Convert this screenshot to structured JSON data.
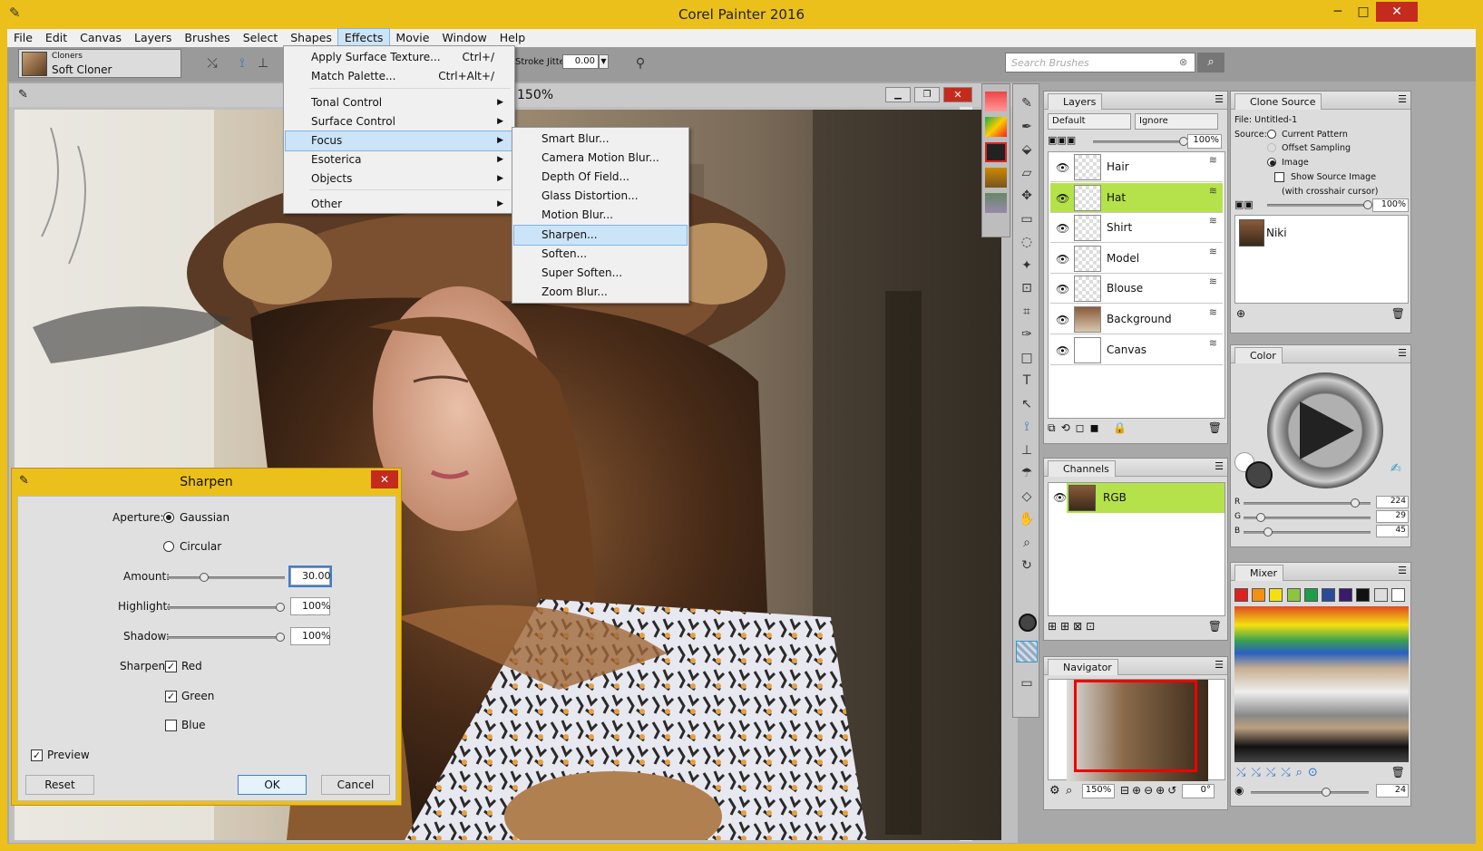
{
  "app": {
    "title": "Corel Painter 2016"
  },
  "menu": [
    "File",
    "Edit",
    "Canvas",
    "Layers",
    "Brushes",
    "Select",
    "Shapes",
    "Effects",
    "Movie",
    "Window",
    "Help"
  ],
  "propbar": {
    "brush_category": "Cloners",
    "brush_variant": "Soft Cloner",
    "stroke_jitter_label": "Stroke Jitter:",
    "stroke_jitter_value": "0.00"
  },
  "search": {
    "placeholder": "Search Brushes"
  },
  "document": {
    "zoom_label": "150%"
  },
  "effects_menu": {
    "items": [
      {
        "label": "Apply Surface Texture...",
        "shortcut": "Ctrl+/"
      },
      {
        "label": "Match Palette...",
        "shortcut": "Ctrl+Alt+/"
      },
      {
        "label": "Tonal Control"
      },
      {
        "label": "Surface Control"
      },
      {
        "label": "Focus"
      },
      {
        "label": "Esoterica"
      },
      {
        "label": "Objects"
      },
      {
        "label": "Other"
      }
    ]
  },
  "focus_menu": {
    "items": [
      "Smart Blur...",
      "Camera Motion Blur...",
      "Depth Of Field...",
      "Glass Distortion...",
      "Motion Blur...",
      "Sharpen...",
      "Soften...",
      "Super Soften...",
      "Zoom Blur..."
    ]
  },
  "sharpen_dialog": {
    "title": "Sharpen",
    "aperture_label": "Aperture:",
    "aperture_options": [
      "Gaussian",
      "Circular"
    ],
    "aperture_selected": "Gaussian",
    "amount_label": "Amount:",
    "amount_value": "30.00",
    "amount_level": 0.3,
    "highlight_label": "Highlight:",
    "highlight_value": "100%",
    "highlight_level": 1.0,
    "shadow_label": "Shadow:",
    "shadow_value": "100%",
    "shadow_level": 1.0,
    "sharpen_label": "Sharpen:",
    "channels": [
      {
        "label": "Red",
        "checked": true
      },
      {
        "label": "Green",
        "checked": true
      },
      {
        "label": "Blue",
        "checked": false
      }
    ],
    "preview_label": "Preview",
    "reset_label": "Reset",
    "ok_label": "OK",
    "cancel_label": "Cancel"
  },
  "layers_panel": {
    "title": "Layers",
    "composite_method": "Default",
    "preserve": "Ignore",
    "opacity": "100%",
    "layers": [
      {
        "name": "Hair",
        "selected": false
      },
      {
        "name": "Hat",
        "selected": true
      },
      {
        "name": "Shirt",
        "selected": false
      },
      {
        "name": "Model",
        "selected": false
      },
      {
        "name": "Blouse",
        "selected": false
      },
      {
        "name": "Background",
        "selected": false
      },
      {
        "name": "Canvas",
        "selected": false
      }
    ]
  },
  "channels_panel": {
    "title": "Channels",
    "channel": "RGB"
  },
  "navigator_panel": {
    "title": "Navigator",
    "zoom": "150%",
    "rotation": "0°"
  },
  "clone_source_panel": {
    "title": "Clone Source",
    "file_label": "File: Untitled-1",
    "source_label": "Source:",
    "options": [
      "Current Pattern",
      "Offset Sampling",
      "Image"
    ],
    "selected": "Image",
    "show_source_label": "Show Source Image",
    "crosshair_label": "(with crosshair cursor)",
    "opacity": "100%",
    "source_image": "Niki"
  },
  "color_panel": {
    "title": "Color",
    "r_label": "R",
    "r": "224",
    "g_label": "G",
    "g": "29",
    "b_label": "B",
    "b": "45"
  },
  "mixer_panel": {
    "title": "Mixer",
    "swatches": [
      "#e02020",
      "#f29010",
      "#f4e010",
      "#8cc63f",
      "#1e9e48",
      "#2a4a9a",
      "#3a1a6a",
      "#111111",
      "#dddddd",
      "#ffffff"
    ],
    "brush_size": "24"
  }
}
